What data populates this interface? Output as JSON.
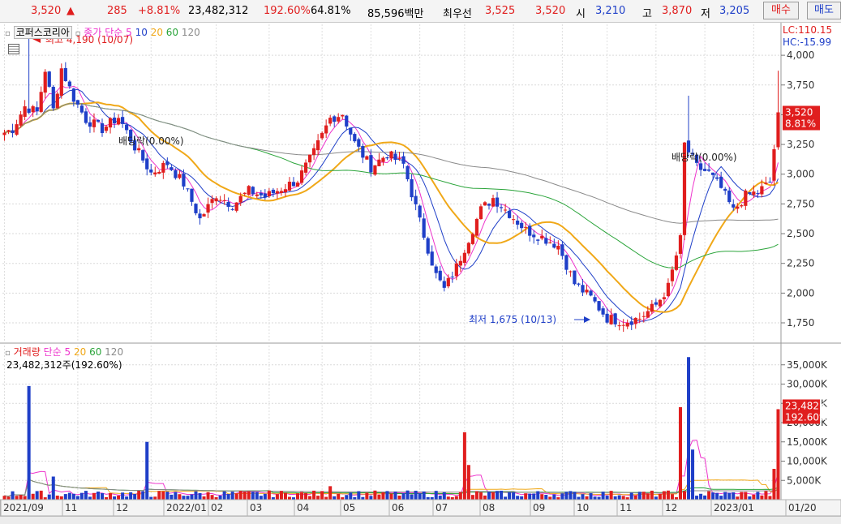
{
  "quote": {
    "price": "3,520",
    "up_mark": "▲",
    "change": "285",
    "change_pct": "+8.81%",
    "volume": "23,482,312",
    "volume_ratio": "192.60%",
    "turnover_pct": "64.81%",
    "amount": "85,596백만",
    "best_label": "최우선",
    "bid": "3,525",
    "ask": "3,520",
    "open_label": "시",
    "open": "3,210",
    "high_label": "고",
    "high": "3,870",
    "low_label": "저",
    "low": "3,205",
    "buy_label": "매수",
    "sell_label": "매도"
  },
  "price_panel": {
    "stock_name": "코퍼스코리아",
    "legend_prefix": "종가 단순",
    "ma": [
      "5",
      "10",
      "20",
      "60",
      "120"
    ],
    "lc": "LC:110.15",
    "hc": "HC:-15.99",
    "high_note": "최고 4,190 (10/07)",
    "low_note": "최저 1,675 (10/13)",
    "dividend_note_1": "배당락(0.00%)",
    "dividend_note_2": "배당락(0.00%)",
    "last_price_label": "3,520",
    "last_pct_label": "8.81%"
  },
  "volume_panel": {
    "title": "거래량",
    "legend_prefix": "단순",
    "ma": [
      "5",
      "20",
      "60",
      "120"
    ],
    "value_text": "23,482,312주(192.60%)",
    "last_label": "23,482K",
    "last_pct_label": "192.60%"
  },
  "colors": {
    "up": "#e01e1e",
    "down": "#1f3fc8",
    "ma5": "#ee33cc",
    "ma10": "#1f3fc8",
    "ma20": "#f0a818",
    "ma60": "#2aa43a",
    "ma120": "#8a8a8a",
    "label_box": "#e01e1e"
  },
  "chart_data": {
    "type": "candlestick",
    "x_tick_labels": [
      "2021/09",
      "11",
      "12",
      "2022/01",
      "02",
      "03",
      "04",
      "05",
      "06",
      "07",
      "08",
      "09",
      "10",
      "11",
      "12",
      "2023/01",
      "01/20"
    ],
    "price_axis": {
      "ticks": [
        "4,000",
        "3,750",
        "3,500",
        "3,250",
        "3,000",
        "2,750",
        "2,500",
        "2,250",
        "2,000",
        "1,750"
      ],
      "ylim": [
        1600,
        4260
      ]
    },
    "volume_axis": {
      "ticks": [
        "35,000K",
        "30,000K",
        "25,000K",
        "20,000K",
        "15,000K",
        "10,000K",
        "5,000K"
      ],
      "ylim": [
        0,
        40000
      ]
    },
    "close_path": [
      {
        "t": 0,
        "p": 3350
      },
      {
        "t": 2,
        "p": 3380
      },
      {
        "t": 5,
        "p": 3570
      },
      {
        "t": 8,
        "p": 3520
      },
      {
        "t": 10,
        "p": 3880
      },
      {
        "t": 12,
        "p": 3540
      },
      {
        "t": 14,
        "p": 3890
      },
      {
        "t": 17,
        "p": 3640
      },
      {
        "t": 20,
        "p": 3460
      },
      {
        "t": 24,
        "p": 3380
      },
      {
        "t": 28,
        "p": 3480
      },
      {
        "t": 32,
        "p": 3230
      },
      {
        "t": 36,
        "p": 3010
      },
      {
        "t": 40,
        "p": 3090
      },
      {
        "t": 44,
        "p": 2920
      },
      {
        "t": 48,
        "p": 2620
      },
      {
        "t": 52,
        "p": 2830
      },
      {
        "t": 56,
        "p": 2740
      },
      {
        "t": 60,
        "p": 2860
      },
      {
        "t": 64,
        "p": 2810
      },
      {
        "t": 68,
        "p": 2880
      },
      {
        "t": 72,
        "p": 2950
      },
      {
        "t": 76,
        "p": 3180
      },
      {
        "t": 80,
        "p": 3470
      },
      {
        "t": 83,
        "p": 3510
      },
      {
        "t": 86,
        "p": 3260
      },
      {
        "t": 90,
        "p": 3060
      },
      {
        "t": 94,
        "p": 3170
      },
      {
        "t": 98,
        "p": 3080
      },
      {
        "t": 102,
        "p": 2600
      },
      {
        "t": 106,
        "p": 2150
      },
      {
        "t": 108,
        "p": 2030
      },
      {
        "t": 111,
        "p": 2220
      },
      {
        "t": 114,
        "p": 2460
      },
      {
        "t": 117,
        "p": 2700
      },
      {
        "t": 120,
        "p": 2800
      },
      {
        "t": 124,
        "p": 2670
      },
      {
        "t": 128,
        "p": 2530
      },
      {
        "t": 132,
        "p": 2470
      },
      {
        "t": 136,
        "p": 2400
      },
      {
        "t": 140,
        "p": 2080
      },
      {
        "t": 144,
        "p": 1960
      },
      {
        "t": 148,
        "p": 1790
      },
      {
        "t": 152,
        "p": 1760
      },
      {
        "t": 156,
        "p": 1790
      },
      {
        "t": 160,
        "p": 1900
      },
      {
        "t": 163,
        "p": 2050
      },
      {
        "t": 166,
        "p": 2450
      },
      {
        "t": 167,
        "p": 3250
      },
      {
        "t": 170,
        "p": 3060
      },
      {
        "t": 173,
        "p": 3010
      },
      {
        "t": 176,
        "p": 2880
      },
      {
        "t": 179,
        "p": 2690
      },
      {
        "t": 182,
        "p": 2820
      },
      {
        "t": 185,
        "p": 2850
      },
      {
        "t": 188,
        "p": 2930
      },
      {
        "t": 189,
        "p": 3210
      },
      {
        "t": 190,
        "p": 3520
      }
    ],
    "volume_spikes": [
      {
        "t": 6,
        "v": 29500
      },
      {
        "t": 12,
        "v": 6000
      },
      {
        "t": 35,
        "v": 15000
      },
      {
        "t": 80,
        "v": 3500
      },
      {
        "t": 113,
        "v": 17500
      },
      {
        "t": 114,
        "v": 9000
      },
      {
        "t": 166,
        "v": 24000
      },
      {
        "t": 168,
        "v": 37000
      },
      {
        "t": 169,
        "v": 13000
      },
      {
        "t": 189,
        "v": 8000
      },
      {
        "t": 190,
        "v": 23482
      }
    ],
    "n_bars": 191
  }
}
